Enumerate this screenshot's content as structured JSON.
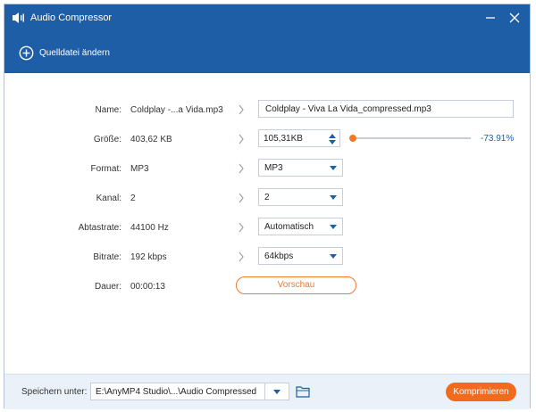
{
  "window": {
    "title": "Audio Compressor"
  },
  "toolbar": {
    "source_label": "Quelldatei ändern"
  },
  "fields": {
    "name": {
      "label": "Name:",
      "original": "Coldplay -...a Vida.mp3",
      "value": "Coldplay - Viva La Vida_compressed.mp3"
    },
    "size": {
      "label": "Größe:",
      "original": "403,62 KB",
      "value": "105,31KB",
      "percent": "-73.91%",
      "slider_fraction": 0.0
    },
    "format": {
      "label": "Format:",
      "original": "MP3",
      "selected": "MP3"
    },
    "channel": {
      "label": "Kanal:",
      "original": "2",
      "selected": "2"
    },
    "samplerate": {
      "label": "Abtastrate:",
      "original": "44100 Hz",
      "selected": "Automatisch"
    },
    "bitrate": {
      "label": "Bitrate:",
      "original": "192 kbps",
      "selected": "64kbps"
    },
    "duration": {
      "label": "Dauer:",
      "original": "00:00:13"
    }
  },
  "preview_label": "Vorschau",
  "footer": {
    "save_label": "Speichern unter:",
    "path": "E:\\AnyMP4 Studio\\...\\Audio Compressed",
    "compress_label": "Komprimieren"
  },
  "colors": {
    "header": "#1d5ea6",
    "accent": "#f26b1d",
    "footer_bg": "#eaf1f8"
  }
}
